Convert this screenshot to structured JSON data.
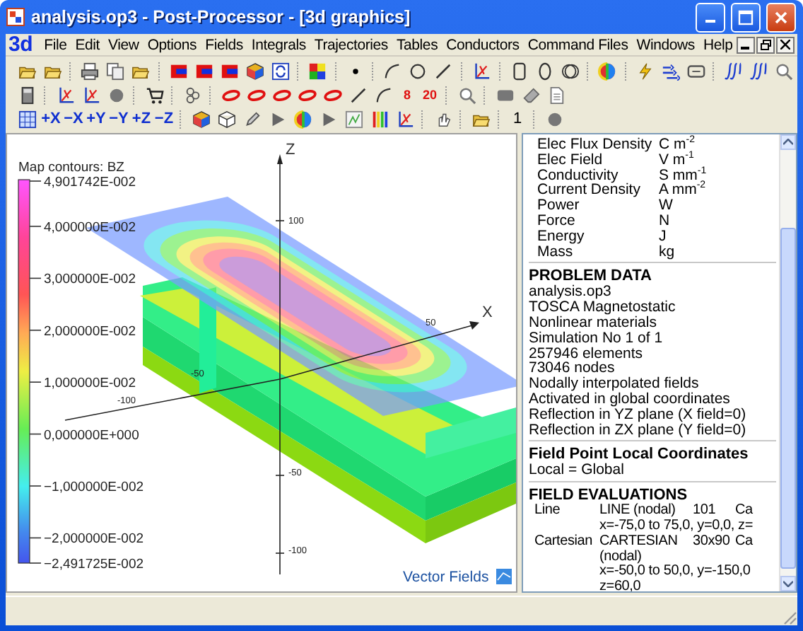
{
  "window": {
    "title": "analysis.op3 - Post-Processor - [3d graphics]"
  },
  "menu": {
    "logo": "3d",
    "items": [
      "File",
      "Edit",
      "View",
      "Options",
      "Fields",
      "Integrals",
      "Trajectories",
      "Tables",
      "Conductors",
      "Command Files",
      "Windows",
      "Help"
    ]
  },
  "toolbars": [
    [
      {
        "kind": "folder"
      },
      {
        "kind": "folder"
      },
      {
        "kind": "separator"
      },
      {
        "kind": "printer"
      },
      {
        "kind": "pages"
      },
      {
        "kind": "folder"
      },
      {
        "kind": "separator"
      },
      {
        "kind": "block"
      },
      {
        "kind": "block"
      },
      {
        "kind": "block"
      },
      {
        "kind": "colorcube"
      },
      {
        "kind": "refresh"
      },
      {
        "kind": "separator"
      },
      {
        "kind": "palette"
      },
      {
        "kind": "separator"
      },
      {
        "kind": "dot"
      },
      {
        "kind": "separator"
      },
      {
        "kind": "arc"
      },
      {
        "kind": "circle"
      },
      {
        "kind": "line"
      },
      {
        "kind": "separator"
      },
      {
        "kind": "axes"
      },
      {
        "kind": "separator"
      },
      {
        "kind": "rect"
      },
      {
        "kind": "ellipse"
      },
      {
        "kind": "rings"
      },
      {
        "kind": "separator"
      },
      {
        "kind": "ball"
      },
      {
        "kind": "separator"
      },
      {
        "kind": "bolt"
      },
      {
        "kind": "vectors"
      },
      {
        "kind": "link"
      },
      {
        "kind": "separator"
      },
      {
        "kind": "integral"
      },
      {
        "kind": "integral"
      },
      {
        "kind": "magnifier"
      }
    ],
    [
      {
        "kind": "calculator"
      },
      {
        "kind": "separator"
      },
      {
        "kind": "axes"
      },
      {
        "kind": "axes"
      },
      {
        "kind": "disk"
      },
      {
        "kind": "separator"
      },
      {
        "kind": "cart"
      },
      {
        "kind": "separator"
      },
      {
        "kind": "chain"
      },
      {
        "kind": "separator"
      },
      {
        "kind": "ring"
      },
      {
        "kind": "ring"
      },
      {
        "kind": "ring"
      },
      {
        "kind": "ring"
      },
      {
        "kind": "ring"
      },
      {
        "kind": "line"
      },
      {
        "kind": "arc"
      },
      {
        "kind": "counter",
        "label": "8"
      },
      {
        "kind": "counter",
        "label": "20"
      },
      {
        "kind": "separator"
      },
      {
        "kind": "magnifier"
      },
      {
        "kind": "separator"
      },
      {
        "kind": "tile"
      },
      {
        "kind": "eraser"
      },
      {
        "kind": "document"
      }
    ],
    [
      {
        "kind": "grid"
      },
      {
        "kind": "text",
        "label": "+X"
      },
      {
        "kind": "text",
        "label": "−X"
      },
      {
        "kind": "text",
        "label": "+Y"
      },
      {
        "kind": "text",
        "label": "−Y"
      },
      {
        "kind": "text",
        "label": "+Z"
      },
      {
        "kind": "text",
        "label": "−Z"
      },
      {
        "kind": "separator"
      },
      {
        "kind": "colorcube"
      },
      {
        "kind": "cubeoutline"
      },
      {
        "kind": "pencil"
      },
      {
        "kind": "play"
      },
      {
        "kind": "ball"
      },
      {
        "kind": "play"
      },
      {
        "kind": "image"
      },
      {
        "kind": "bars"
      },
      {
        "kind": "axes"
      },
      {
        "kind": "separator"
      },
      {
        "kind": "hand"
      },
      {
        "kind": "separator"
      },
      {
        "kind": "folder"
      },
      {
        "kind": "separator"
      },
      {
        "kind": "plain",
        "label": "1"
      },
      {
        "kind": "separator"
      },
      {
        "kind": "disk"
      }
    ]
  ],
  "plot": {
    "legend": {
      "title": "Map contours: BZ",
      "labels": [
        "4,901742E-002",
        "4,000000E-002",
        "3,000000E-002",
        "2,000000E-002",
        "1,000000E-002",
        "0,000000E+000",
        "−1,000000E-002",
        "−2,000000E-002",
        "−2,491725E-002"
      ]
    },
    "axis_labels": [
      "Z",
      "X"
    ],
    "tick_labels": [
      "100",
      "50",
      "-50",
      "-100",
      "-50",
      "-100"
    ],
    "brand": "Vector Fields"
  },
  "units": [
    {
      "quantity": "Elec Flux Density",
      "unit": "C m$^{-2}$"
    },
    {
      "quantity": "Elec Field",
      "unit": "V m$^{-1}$"
    },
    {
      "quantity": "Conductivity",
      "unit": "S mm$^{-1}$"
    },
    {
      "quantity": "Current Density",
      "unit": "A mm$^{-2}$"
    },
    {
      "quantity": "Power",
      "unit": "W"
    },
    {
      "quantity": "Force",
      "unit": "N"
    },
    {
      "quantity": "Energy",
      "unit": "J"
    },
    {
      "quantity": "Mass",
      "unit": "kg"
    }
  ],
  "problem_data": {
    "heading": "PROBLEM DATA",
    "lines": [
      "analysis.op3",
      "TOSCA Magnetostatic",
      "Nonlinear materials",
      "Simulation No 1 of 1",
      "257946 elements",
      "73046 nodes",
      "Nodally interpolated fields",
      "Activated in global coordinates",
      "Reflection in YZ plane (X field=0)",
      "Reflection in ZX plane (Y field=0)"
    ]
  },
  "local_coordinates": {
    "heading": "Field Point Local Coordinates",
    "lines": [
      "Local = Global"
    ]
  },
  "field_evaluations": {
    "heading": "FIELD EVALUATIONS",
    "rows": [
      {
        "name": "Line",
        "type_lines": [
          "LINE (nodal)"
        ],
        "count": "101",
        "column_4": "Ca",
        "range_lines": [
          "x=-75,0 to 75,0, y=0,0, z="
        ]
      },
      {
        "name": "Cartesian",
        "type_lines": [
          "CARTESIAN",
          "(nodal)"
        ],
        "count": "30x90",
        "column_4": "Ca",
        "range_lines": [
          "x=-50,0 to 50,0, y=-150,0",
          "z=60,0"
        ]
      }
    ]
  }
}
